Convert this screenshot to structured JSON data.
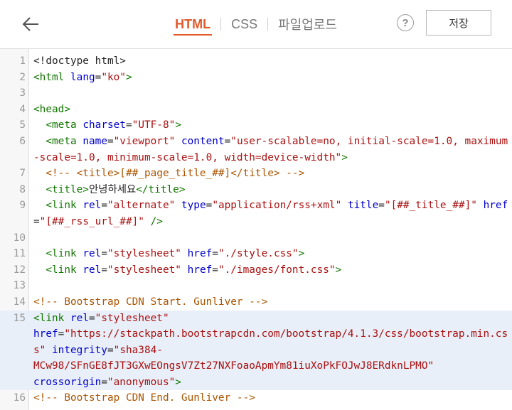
{
  "header": {
    "tabs": [
      {
        "label": "HTML",
        "active": true
      },
      {
        "label": "CSS",
        "active": false
      },
      {
        "label": "파일업로드",
        "active": false
      }
    ],
    "help_label": "?",
    "save_label": "저장",
    "accent_color": "#e05a2a"
  },
  "editor": {
    "lines": [
      {
        "n": "1",
        "tokens": [
          {
            "k": "p",
            "v": "<!doctype html>"
          }
        ]
      },
      {
        "n": "2",
        "tokens": [
          {
            "k": "t",
            "v": "<html"
          },
          {
            "k": "p",
            "v": " "
          },
          {
            "k": "a",
            "v": "lang"
          },
          {
            "k": "p",
            "v": "="
          },
          {
            "k": "s",
            "v": "\"ko\""
          },
          {
            "k": "t",
            "v": ">"
          }
        ]
      },
      {
        "n": "3",
        "tokens": []
      },
      {
        "n": "4",
        "tokens": [
          {
            "k": "t",
            "v": "<head>"
          }
        ]
      },
      {
        "n": "5",
        "tokens": [
          {
            "k": "p",
            "v": "  "
          },
          {
            "k": "t",
            "v": "<meta"
          },
          {
            "k": "p",
            "v": " "
          },
          {
            "k": "a",
            "v": "charset"
          },
          {
            "k": "p",
            "v": "="
          },
          {
            "k": "s",
            "v": "\"UTF-8\""
          },
          {
            "k": "t",
            "v": ">"
          }
        ]
      },
      {
        "n": "6",
        "tokens": [
          {
            "k": "p",
            "v": "  "
          },
          {
            "k": "t",
            "v": "<meta"
          },
          {
            "k": "p",
            "v": " "
          },
          {
            "k": "a",
            "v": "name"
          },
          {
            "k": "p",
            "v": "="
          },
          {
            "k": "s",
            "v": "\"viewport\""
          },
          {
            "k": "p",
            "v": " "
          },
          {
            "k": "a",
            "v": "content"
          },
          {
            "k": "p",
            "v": "="
          },
          {
            "k": "s",
            "v": "\"user-scalable=no, initial-scale=1.0, maximum-scale=1.0, minimum-scale=1.0, width=device-width\""
          },
          {
            "k": "t",
            "v": ">"
          }
        ]
      },
      {
        "n": "7",
        "tokens": [
          {
            "k": "p",
            "v": "  "
          },
          {
            "k": "c",
            "v": "<!-- <title>[##_page_title_##]</title> -->"
          }
        ]
      },
      {
        "n": "8",
        "tokens": [
          {
            "k": "p",
            "v": "  "
          },
          {
            "k": "t",
            "v": "<title>"
          },
          {
            "k": "p",
            "v": "안녕하세요"
          },
          {
            "k": "t",
            "v": "</title>"
          }
        ]
      },
      {
        "n": "9",
        "tokens": [
          {
            "k": "p",
            "v": "  "
          },
          {
            "k": "t",
            "v": "<link"
          },
          {
            "k": "p",
            "v": " "
          },
          {
            "k": "a",
            "v": "rel"
          },
          {
            "k": "p",
            "v": "="
          },
          {
            "k": "s",
            "v": "\"alternate\""
          },
          {
            "k": "p",
            "v": " "
          },
          {
            "k": "a",
            "v": "type"
          },
          {
            "k": "p",
            "v": "="
          },
          {
            "k": "s",
            "v": "\"application/rss+xml\""
          },
          {
            "k": "p",
            "v": " "
          },
          {
            "k": "a",
            "v": "title"
          },
          {
            "k": "p",
            "v": "="
          },
          {
            "k": "s",
            "v": "\"[##_title_##]\""
          },
          {
            "k": "p",
            "v": " "
          },
          {
            "k": "a",
            "v": "href"
          },
          {
            "k": "p",
            "v": "="
          },
          {
            "k": "s",
            "v": "\"[##_rss_url_##]\""
          },
          {
            "k": "p",
            "v": " "
          },
          {
            "k": "t",
            "v": "/>"
          }
        ]
      },
      {
        "n": "10",
        "tokens": []
      },
      {
        "n": "11",
        "tokens": [
          {
            "k": "p",
            "v": "  "
          },
          {
            "k": "t",
            "v": "<link"
          },
          {
            "k": "p",
            "v": " "
          },
          {
            "k": "a",
            "v": "rel"
          },
          {
            "k": "p",
            "v": "="
          },
          {
            "k": "s",
            "v": "\"stylesheet\""
          },
          {
            "k": "p",
            "v": " "
          },
          {
            "k": "a",
            "v": "href"
          },
          {
            "k": "p",
            "v": "="
          },
          {
            "k": "s",
            "v": "\"./style.css\""
          },
          {
            "k": "t",
            "v": ">"
          }
        ]
      },
      {
        "n": "12",
        "tokens": [
          {
            "k": "p",
            "v": "  "
          },
          {
            "k": "t",
            "v": "<link"
          },
          {
            "k": "p",
            "v": " "
          },
          {
            "k": "a",
            "v": "rel"
          },
          {
            "k": "p",
            "v": "="
          },
          {
            "k": "s",
            "v": "\"stylesheet\""
          },
          {
            "k": "p",
            "v": " "
          },
          {
            "k": "a",
            "v": "href"
          },
          {
            "k": "p",
            "v": "="
          },
          {
            "k": "s",
            "v": "\"./images/font.css\""
          },
          {
            "k": "t",
            "v": ">"
          }
        ]
      },
      {
        "n": "13",
        "tokens": []
      },
      {
        "n": "14",
        "tokens": [
          {
            "k": "c",
            "v": "<!-- Bootstrap CDN Start. Gunliver -->"
          }
        ]
      },
      {
        "n": "15",
        "hl": true,
        "tokens": [
          {
            "k": "t",
            "v": "<link"
          },
          {
            "k": "p",
            "v": " "
          },
          {
            "k": "a",
            "v": "rel"
          },
          {
            "k": "p",
            "v": "="
          },
          {
            "k": "s",
            "v": "\"stylesheet\""
          },
          {
            "k": "p",
            "v": "\n"
          },
          {
            "k": "a",
            "v": "href"
          },
          {
            "k": "p",
            "v": "="
          },
          {
            "k": "s",
            "v": "\"https://stackpath.bootstrapcdn.com/bootstrap/4.1.3/css/bootstrap.min.css\""
          },
          {
            "k": "p",
            "v": " "
          },
          {
            "k": "a",
            "v": "integrity"
          },
          {
            "k": "p",
            "v": "="
          },
          {
            "k": "s",
            "v": "\"sha384-\nMCw98/SFnGE8fJT3GXwEOngsV7Zt27NXFoaoApmYm81iuXoPkFOJwJ8ERdknLPMO\""
          },
          {
            "k": "p",
            "v": "\n"
          },
          {
            "k": "a",
            "v": "crossorigin"
          },
          {
            "k": "p",
            "v": "="
          },
          {
            "k": "s",
            "v": "\"anonymous\""
          },
          {
            "k": "t",
            "v": ">"
          }
        ]
      },
      {
        "n": "16",
        "tokens": [
          {
            "k": "c",
            "v": "<!-- Bootstrap CDN End. Gunliver -->"
          }
        ]
      }
    ]
  }
}
